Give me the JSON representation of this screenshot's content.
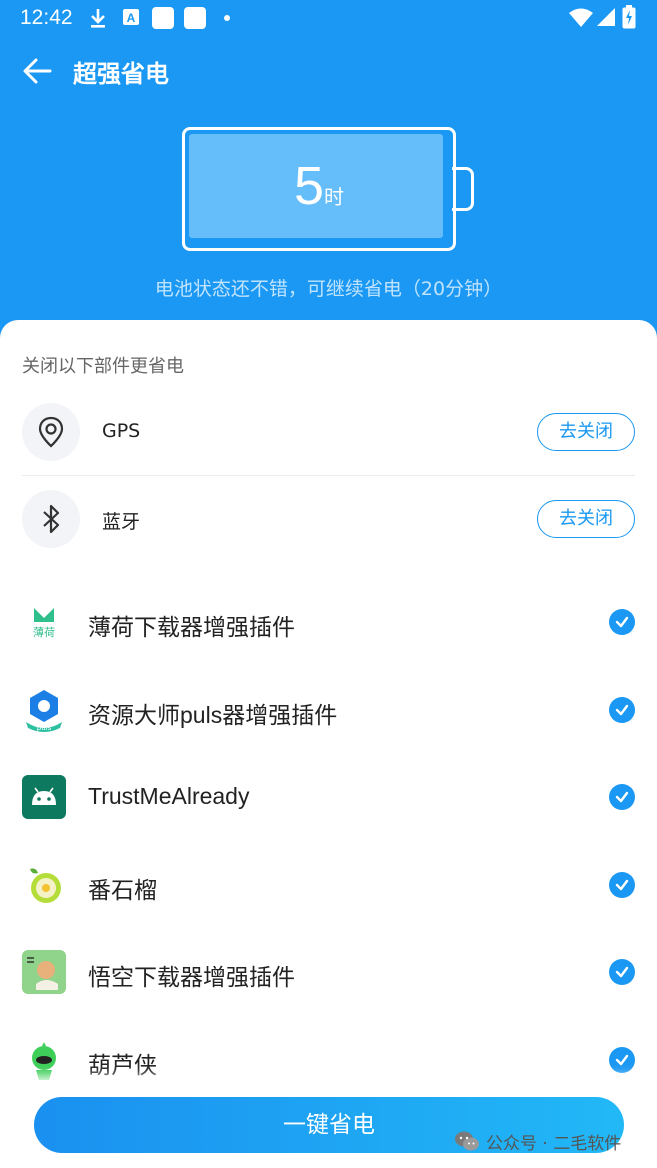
{
  "status_bar": {
    "time": "12:42",
    "icons": [
      "download-icon",
      "font-icon",
      "app-square-icon",
      "app-square-icon",
      "dot-icon",
      "wifi-icon",
      "signal-icon",
      "battery-charging-icon"
    ]
  },
  "app_bar": {
    "title": "超强省电",
    "back_icon": "arrow-left-icon"
  },
  "battery": {
    "value": "5",
    "unit": "时",
    "status_text": "电池状态还不错，可继续省电（20分钟）"
  },
  "components": {
    "section_title": "关闭以下部件更省电",
    "items": [
      {
        "label": "GPS",
        "icon": "location-pin-icon",
        "button": "去关闭"
      },
      {
        "label": "蓝牙",
        "icon": "bluetooth-icon",
        "button": "去关闭"
      }
    ]
  },
  "apps": [
    {
      "name": "薄荷下载器增强插件",
      "icon": "mint-app-icon",
      "checked": true
    },
    {
      "name": "资源大师puls器增强插件",
      "icon": "resource-master-app-icon",
      "checked": true
    },
    {
      "name": "TrustMeAlready",
      "icon": "android-app-icon",
      "checked": true
    },
    {
      "name": "番石榴",
      "icon": "guava-app-icon",
      "checked": true
    },
    {
      "name": "悟空下载器增强插件",
      "icon": "wukong-app-icon",
      "checked": true
    },
    {
      "name": "葫芦侠",
      "icon": "huluxia-app-icon",
      "checked": true
    }
  ],
  "main_button": "一键省电",
  "watermark": "公众号 · 二毛软件",
  "colors": {
    "primary": "#1a98f3",
    "battery_fill": "#65bdfa",
    "check": "#1a98f3"
  }
}
